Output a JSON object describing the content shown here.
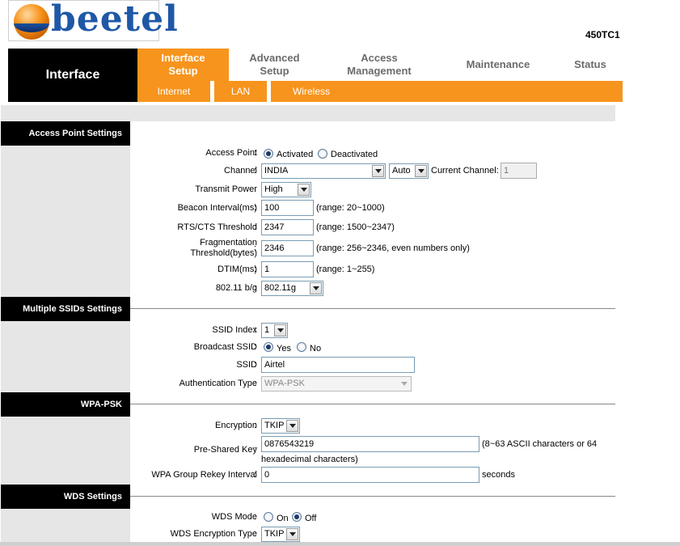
{
  "header": {
    "logo_text": "beetel",
    "model": "450TC1"
  },
  "nav": {
    "current": "Interface",
    "main_tabs": [
      {
        "label1": "Interface",
        "label2": "Setup"
      },
      {
        "label1": "Advanced",
        "label2": "Setup"
      },
      {
        "label1": "Access",
        "label2": "Management"
      },
      {
        "label1": "Maintenance",
        "label2": ""
      },
      {
        "label1": "Status",
        "label2": ""
      }
    ],
    "sub_tabs": [
      "Internet",
      "LAN",
      "Wireless"
    ]
  },
  "sections": {
    "access_point": "Access Point Settings",
    "multiple_ssid": "Multiple SSIDs Settings",
    "wpa_psk": "WPA-PSK",
    "wds": "WDS Settings"
  },
  "ap": {
    "access_point_label": "Access Point",
    "activated": "Activated",
    "deactivated": "Deactivated",
    "channel_label": "Channel",
    "channel_value": "INDIA",
    "channel_auto": "Auto",
    "current_channel_label": "Current Channel:",
    "current_channel_value": "1",
    "transmit_power_label": "Transmit Power",
    "transmit_power_value": "High",
    "beacon_label": "Beacon Interval(ms)",
    "beacon_value": "100",
    "beacon_range": "(range: 20~1000)",
    "rts_label": "RTS/CTS Threshold",
    "rts_value": "2347",
    "rts_range": "(range: 1500~2347)",
    "frag_label1": "Fragmentation",
    "frag_label2": "Threshold(bytes)",
    "frag_value": "2346",
    "frag_range": "(range: 256~2346, even numbers only)",
    "dtim_label": "DTIM(ms)",
    "dtim_value": "1",
    "dtim_range": "(range: 1~255)",
    "mode_label": "802.11 b/g",
    "mode_value": "802.11g"
  },
  "ssid": {
    "index_label": "SSID Index",
    "index_value": "1",
    "broadcast_label": "Broadcast SSID",
    "yes": "Yes",
    "no": "No",
    "ssid_label": "SSID",
    "ssid_value": "Airtel",
    "auth_label": "Authentication Type",
    "auth_value": "WPA-PSK"
  },
  "wpa": {
    "encryption_label": "Encryption",
    "encryption_value": "TKIP",
    "psk_label": "Pre-Shared Key",
    "psk_value": "0876543219",
    "psk_hint1": "(8~63 ASCII characters or 64",
    "psk_hint2": "hexadecimal characters)",
    "rekey_label": "WPA Group Rekey Interval",
    "rekey_value": "0",
    "rekey_unit": "seconds"
  },
  "wds": {
    "mode_label": "WDS Mode",
    "on": "On",
    "off": "Off",
    "enc_label": "WDS Encryption Type",
    "enc_value": "TKIP"
  }
}
